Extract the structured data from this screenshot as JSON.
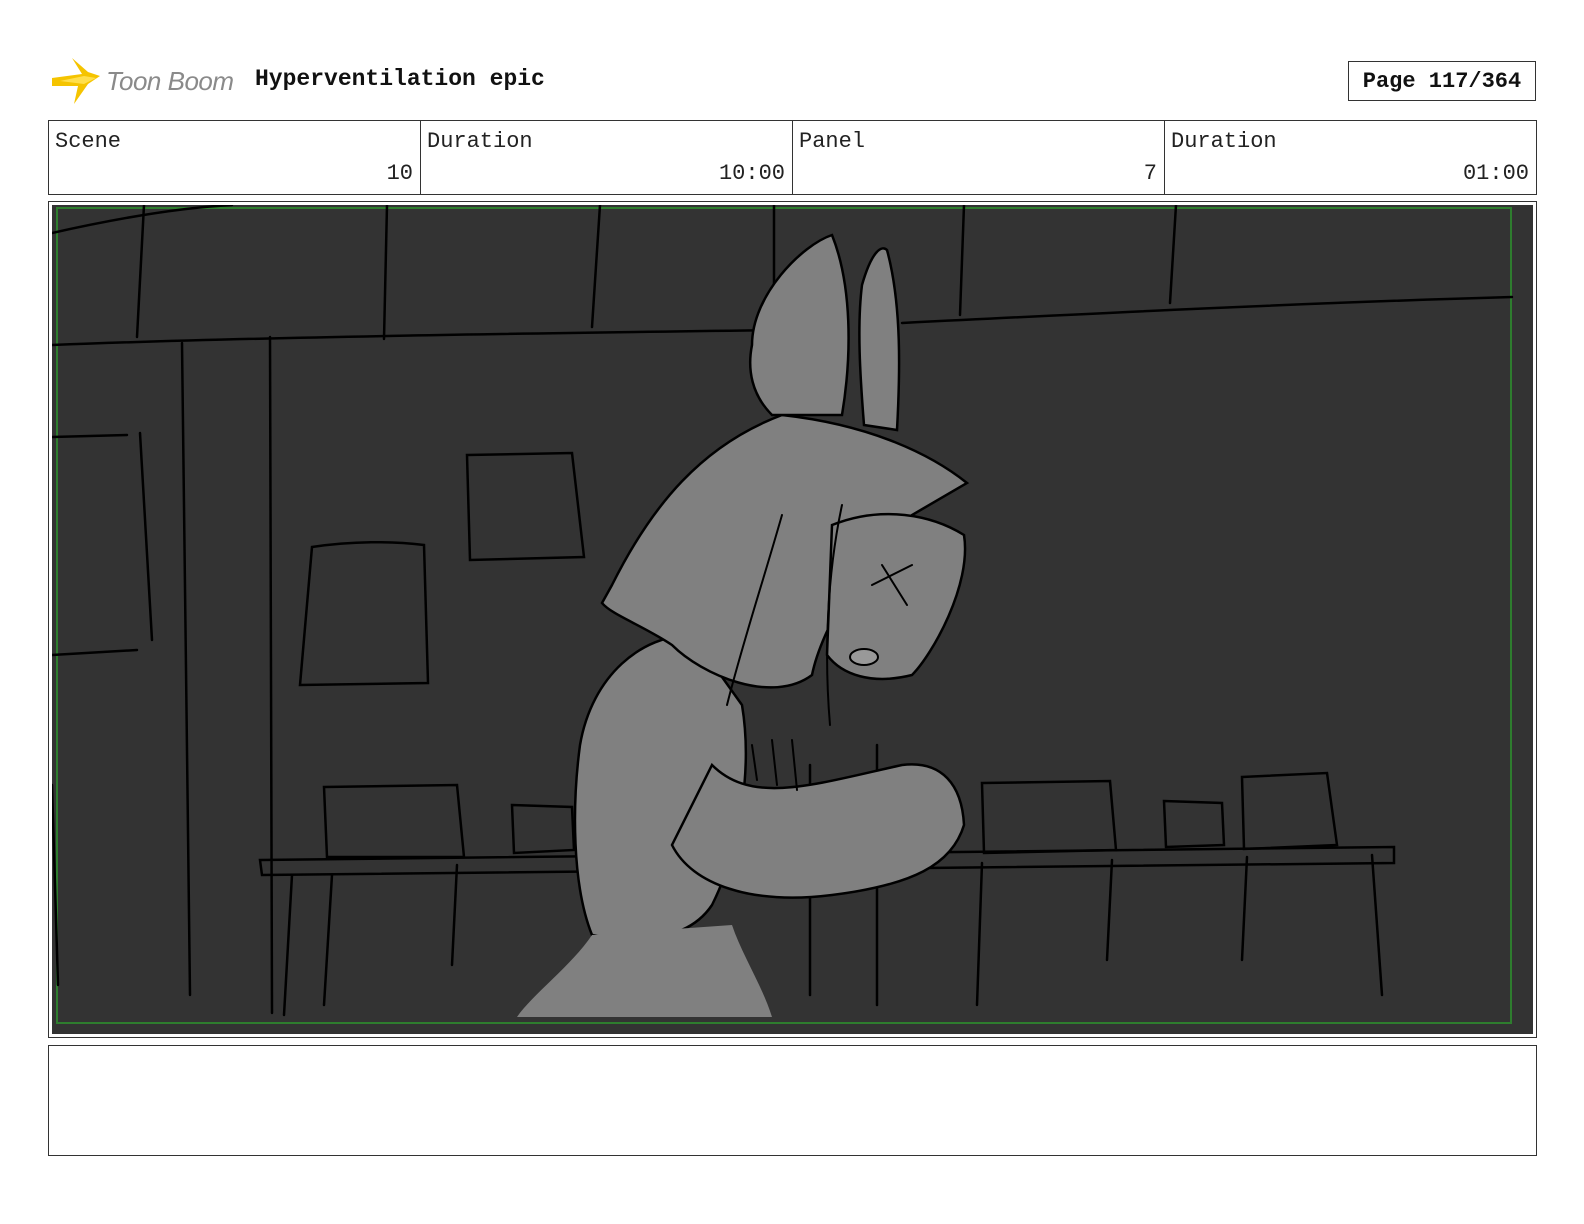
{
  "header": {
    "logo_text": "Toon Boom",
    "project_title": "Hyperventilation epic",
    "page_label": "Page 117/364"
  },
  "info": [
    {
      "label": "Scene",
      "value": "10"
    },
    {
      "label": "Duration",
      "value": "10:00"
    },
    {
      "label": "Panel",
      "value": "7"
    },
    {
      "label": "Duration",
      "value": "01:00"
    }
  ],
  "colors": {
    "panel_background": "#333333",
    "character_fill": "#808080",
    "safe_area_border": "#2e7d2e",
    "logo_yellow": "#f5c400"
  },
  "notes": ""
}
